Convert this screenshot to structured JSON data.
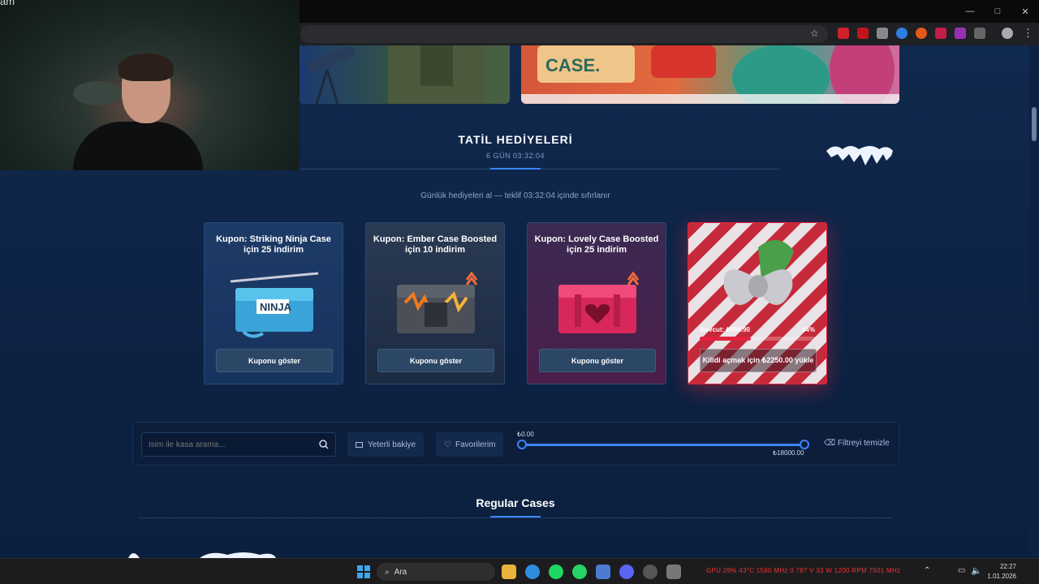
{
  "webcam": {
    "overlay_text": "am"
  },
  "browser": {
    "window_controls": [
      "—",
      "□",
      "✕"
    ]
  },
  "holiday": {
    "title": "TATİL HEDİYELERİ",
    "timer": "6 GÜN  03:32:04",
    "subtitle": "Günlük hediyeleri al — teklif 03:32:04 içinde sıfırlanır"
  },
  "cards": [
    {
      "title": "Kupon: Striking Ninja Case için 25 indirim",
      "button": "Kuponu göster"
    },
    {
      "title": "Kupon: Ember Case Boosted için 10 indirim",
      "button": "Kuponu göster"
    },
    {
      "title": "Kupon: Lovely Case Boosted için 25 indirim",
      "button": "Kuponu göster"
    },
    {
      "available_label": "Mevcut: ₺999.90",
      "progress_pct_label": "44%",
      "progress": 0.44,
      "button": "Kilidi açmak için ₺2250.00 yükle"
    }
  ],
  "filters": {
    "search_placeholder": "İsim ile kasa arama...",
    "sufficient_balance": "Yeterli bakiye",
    "favorites": "Favorilerim",
    "price_min": "₺0.00",
    "price_max": "₺18000.00",
    "clear": "Filtreyi temizle"
  },
  "regular": {
    "title": "Regular Cases"
  },
  "taskbar": {
    "search": "Ara",
    "stats": "GPU  29%  43°C  1590 MHz  0.787 V  33 W  1200 RPM  7501 MHz",
    "time": "22:27",
    "date": "1.01.2026"
  },
  "colors": {
    "accent": "#3a86ff",
    "background": "#0f2447",
    "danger": "#e0233f"
  }
}
